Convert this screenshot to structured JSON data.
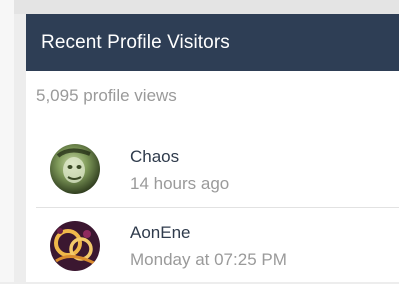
{
  "widget": {
    "title": "Recent Profile Visitors",
    "profile_views": "5,095 profile views"
  },
  "visitors": [
    {
      "name": "Chaos",
      "time": "14 hours ago",
      "avatar_icon": "user-avatar-chaos"
    },
    {
      "name": "AonEne",
      "time": "Monday at 07:25 PM",
      "avatar_icon": "user-avatar-aonene"
    }
  ],
  "colors": {
    "header_bg": "#2e3e55",
    "header_text": "#ffffff",
    "name_text": "#2f3b4c",
    "muted_text": "#9a9a9a"
  }
}
